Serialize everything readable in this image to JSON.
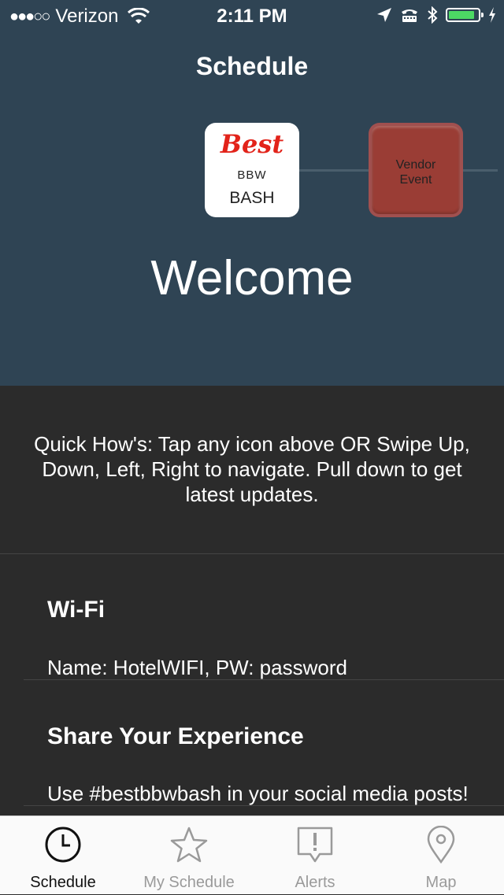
{
  "status_bar": {
    "signal": "●●●○○",
    "carrier": "Verizon",
    "time": "2:11 PM",
    "battery_level_percent": 90,
    "icons": [
      "wifi-icon",
      "location-icon",
      "tty-icon",
      "bluetooth-icon",
      "battery-icon",
      "charging-icon"
    ]
  },
  "nav": {
    "title": "Schedule"
  },
  "carousel": {
    "logo": {
      "best": "Best",
      "bbw": "BBW",
      "bash": "BASH"
    },
    "vendor": {
      "line1": "Vendor",
      "line2": "Event"
    }
  },
  "welcome": "Welcome",
  "quick_hows": "Quick How's:  Tap any icon above OR Swipe Up, Down, Left, Right to navigate.  Pull down to get latest updates.",
  "sections": [
    {
      "heading": "Wi-Fi",
      "body": "Name: HotelWIFI, PW: password"
    },
    {
      "heading": "Share Your Experience",
      "body": "Use #bestbbwbash in your social media posts!"
    }
  ],
  "tabs": [
    {
      "label": "Schedule",
      "icon": "clock-icon",
      "active": true
    },
    {
      "label": "My Schedule",
      "icon": "star-icon",
      "active": false
    },
    {
      "label": "Alerts",
      "icon": "alert-bubble-icon",
      "active": false
    },
    {
      "label": "Map",
      "icon": "map-pin-icon",
      "active": false
    }
  ],
  "colors": {
    "header_bg": "#2f4454",
    "content_bg": "#2b2b2b",
    "brand_red": "#e2231a",
    "vendor_red": "#9a3d35",
    "battery_green": "#4cd964"
  }
}
